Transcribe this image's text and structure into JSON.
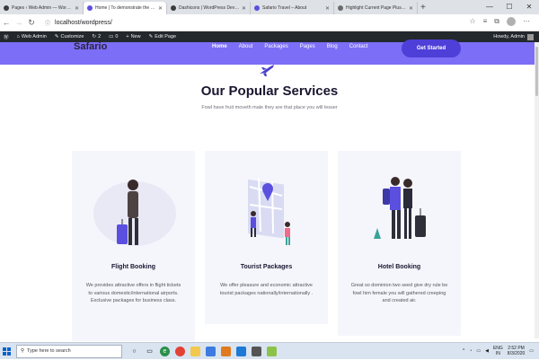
{
  "browser": {
    "tabs": [
      {
        "title": "Pages ‹ Web Admin — WordPress",
        "favicon_color": "#3c3c3c",
        "active": false
      },
      {
        "title": "Home | To demonstrate the cus",
        "favicon_color": "#5b4fe0",
        "active": true
      },
      {
        "title": "Dashicons | WordPress Develope",
        "favicon_color": "#3c3c3c",
        "active": false
      },
      {
        "title": "Safario Travel – About",
        "favicon_color": "#5b4fe0",
        "active": false
      },
      {
        "title": "Highlight Current Page Plus Tuto",
        "favicon_color": "#6b6b6b",
        "active": false
      }
    ],
    "url": "localhost/wordpress/"
  },
  "wp_admin_bar": {
    "site": "Web Admin",
    "customize": "Customize",
    "updates": "2",
    "comments": "0",
    "new": "New",
    "edit": "Edit Page",
    "howdy": "Howdy, Admin"
  },
  "site": {
    "logo": "Safario",
    "menu": [
      "Home",
      "About",
      "Packages",
      "Pages",
      "Blog",
      "Contact"
    ],
    "cta": "Get Started",
    "accent": "#7c6ef6"
  },
  "section": {
    "title": "Our Popular Services",
    "subtitle": "Fowl have fruit moveth male they are that place you will lesser"
  },
  "cards": [
    {
      "title": "Flight Booking",
      "text": "We provides attractive offers in flight tickets to various domestic/international airports. Exclusive packages for business class."
    },
    {
      "title": "Tourist Packages",
      "text": "We offer pleasure and economic attractive tourist packages nationally/internationally ."
    },
    {
      "title": "Hotel Booking",
      "text": "Great so dominion two seed give dry rule be fowl him female you will gathered creeping and created air."
    }
  ],
  "taskbar": {
    "search_placeholder": "Type here to search",
    "lang": "ENG",
    "region": "IN",
    "time": "2:52 PM",
    "date": "8/3/2020"
  }
}
